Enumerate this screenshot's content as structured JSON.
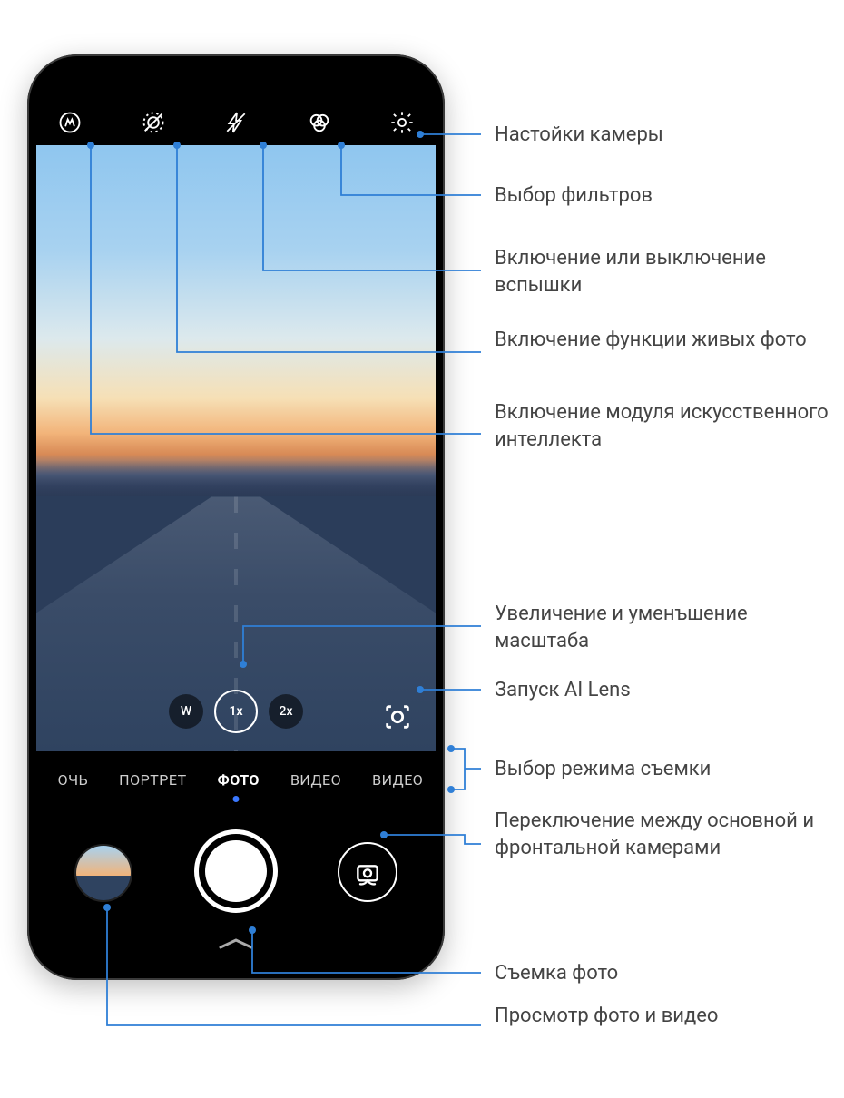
{
  "topbar": {
    "icons": [
      "ai-icon",
      "live-photo-icon",
      "flash-off-icon",
      "filters-icon",
      "gear-icon"
    ]
  },
  "zoom": {
    "w": "W",
    "x1": "1x",
    "x2": "2x"
  },
  "modes": {
    "items": [
      "ОЧЬ",
      "ПОРТРЕТ",
      "ФОТО",
      "ВИДЕО",
      "ВИДЕО"
    ],
    "active_index": 2
  },
  "callouts": {
    "settings": "Настойки камеры",
    "filters": "Выбор фильтров",
    "flash": "Включение или выключение вспышки",
    "live": "Включение функции живых фото",
    "ai": "Включение модуля искусственного интеллекта",
    "zoom": "Увеличение и уменъшение масштаба",
    "ailens": "Запуск AI Lens",
    "mode": "Выбор режима съемки",
    "swap": "Переключение между основной и фронтальной камерами",
    "shutter": "Съемка фото",
    "gallery": "Просмотр фото и видео"
  }
}
